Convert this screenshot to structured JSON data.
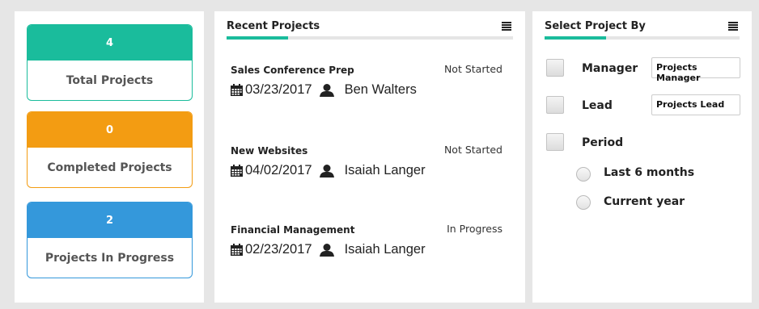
{
  "stats": [
    {
      "count": "4",
      "label": "Total Projects"
    },
    {
      "count": "0",
      "label": "Completed Projects"
    },
    {
      "count": "2",
      "label": "Projects In Progress"
    }
  ],
  "recent": {
    "title": "Recent Projects",
    "projects": [
      {
        "name": "Sales Conference Prep",
        "status": "Not Started",
        "date": "03/23/2017",
        "person": "Ben Walters"
      },
      {
        "name": "New Websites",
        "status": "Not Started",
        "date": "04/02/2017",
        "person": "Isaiah Langer"
      },
      {
        "name": "Financial Management",
        "status": "In Progress",
        "date": "02/23/2017",
        "person": "Isaiah Langer"
      }
    ]
  },
  "filter": {
    "title": "Select Project By",
    "manager_label": "Manager",
    "manager_value": "Projects Manager",
    "lead_label": "Lead",
    "lead_value": "Projects Lead",
    "period_label": "Period",
    "period_options": [
      "Last 6 months",
      "Current year"
    ]
  },
  "colors": {
    "teal": "#1abc9c",
    "orange": "#f39c12",
    "blue": "#3498db"
  }
}
